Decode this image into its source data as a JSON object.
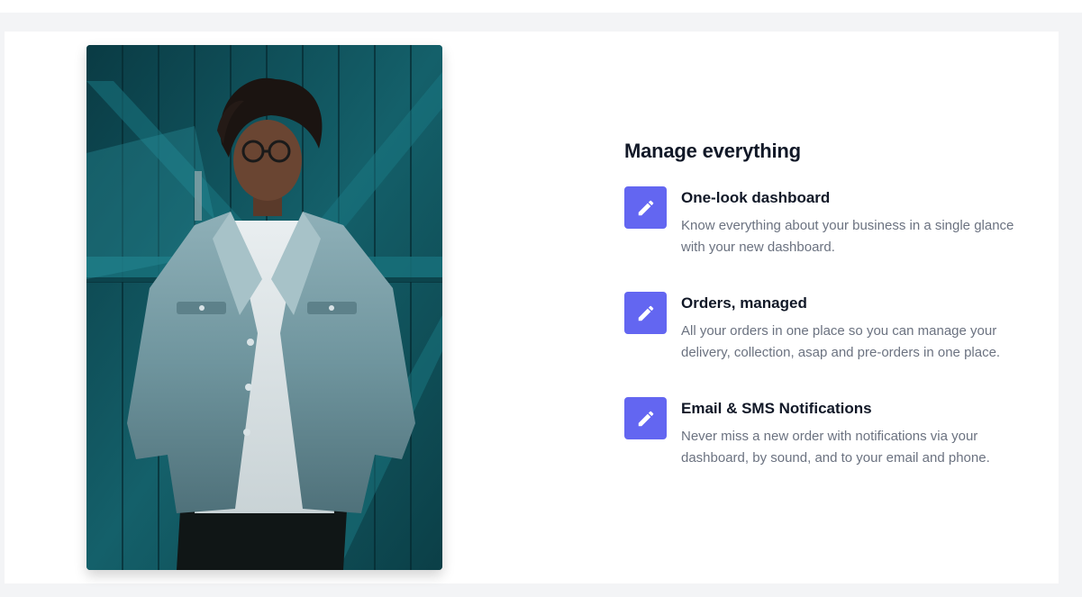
{
  "section": {
    "heading": "Manage everything",
    "image": {
      "icon": "photo-person-denim-jacket",
      "alt": "Person wearing denim jacket in front of a teal wooden door"
    },
    "features": [
      {
        "icon": "pencil-icon",
        "title": "One-look dashboard",
        "description": "Know everything about your business in a single glance with your new dashboard."
      },
      {
        "icon": "pencil-icon",
        "title": "Orders, managed",
        "description": "All your orders in one place so you can manage your delivery, collection, asap and pre-orders in one place."
      },
      {
        "icon": "pencil-icon",
        "title": "Email & SMS Notifications",
        "description": "Never miss a new order with notifications via your dashboard, by sound, and to your email and phone."
      }
    ]
  },
  "colors": {
    "accent": "#6366f1",
    "heading": "#111827",
    "body_text": "#6b7280",
    "page_background": "#f3f4f6"
  }
}
